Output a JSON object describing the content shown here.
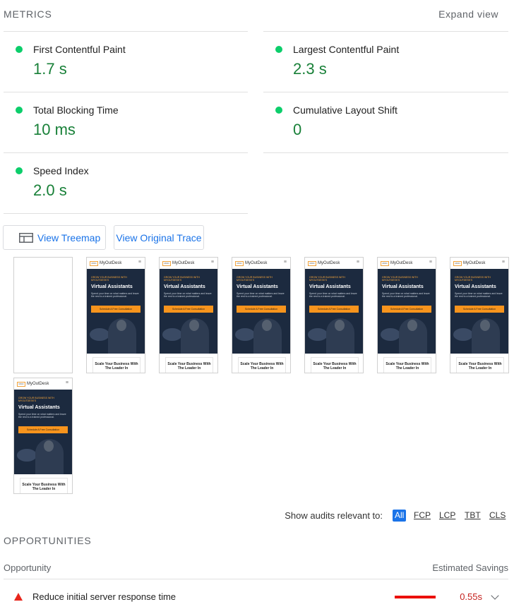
{
  "metrics_section": {
    "title": "METRICS",
    "expand_label": "Expand view",
    "items": [
      {
        "label": "First Contentful Paint",
        "value": "1.7 s"
      },
      {
        "label": "Largest Contentful Paint",
        "value": "2.3 s"
      },
      {
        "label": "Total Blocking Time",
        "value": "10 ms"
      },
      {
        "label": "Cumulative Layout Shift",
        "value": "0"
      },
      {
        "label": "Speed Index",
        "value": "2.0 s"
      }
    ],
    "status_color": "#0cce6b",
    "value_color": "#188038"
  },
  "buttons": {
    "treemap": "View Treemap",
    "trace": "View Original Trace",
    "treemap_icon": "treemap-icon"
  },
  "filmstrip": {
    "logo_text": "MyOutDesk",
    "logo_mark": "MOD",
    "menu_icon": "≡",
    "tagline": "GROW YOUR BUSINESS WITH MYOUTDESK'S",
    "headline": "Virtual Assistants",
    "description": "Spend your time on what matters and leave the rest to a trained professional.",
    "cta": "Schedule A Free Consultation",
    "card_text": "Scale Your Business With The Leader In"
  },
  "filter": {
    "label": "Show audits relevant to:",
    "chips": [
      "All",
      "FCP",
      "LCP",
      "TBT",
      "CLS"
    ]
  },
  "opportunities": {
    "title": "OPPORTUNITIES",
    "col_opportunity": "Opportunity",
    "col_savings": "Estimated Savings",
    "items": [
      {
        "label": "Reduce initial server response time",
        "value": "0.55s"
      }
    ],
    "alert_color": "#e8261c"
  }
}
